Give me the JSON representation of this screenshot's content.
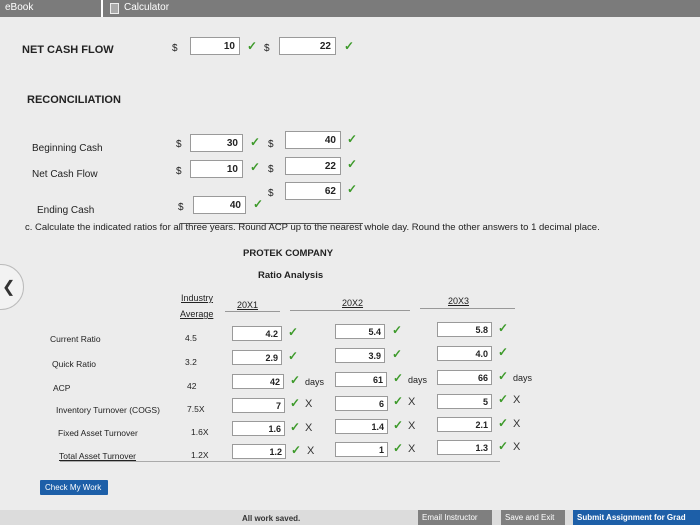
{
  "tabs": {
    "ebook": "eBook",
    "calculator": "Calculator"
  },
  "net_cash_flow": {
    "label": "NET CASH FLOW",
    "currency": "$",
    "val1": "10",
    "val2": "22"
  },
  "reconciliation": {
    "title": "RECONCILIATION",
    "currency": "$",
    "beginning_label": "Beginning Cash",
    "beginning_1": "30",
    "beginning_2": "40",
    "net_label": "Net Cash Flow",
    "net_1": "10",
    "net_2": "22",
    "extra_2": "62",
    "ending_label": "Ending Cash",
    "ending_1": "40"
  },
  "instruction": "c. Calculate the indicated ratios for all three years. Round ACP up to the nearest whole day. Round the other answers to 1 decimal place.",
  "company": "PROTEK COMPANY",
  "analysis_title": "Ratio Analysis",
  "columns": {
    "industry_1": "Industry",
    "industry_2": "Average",
    "y1": "20X1",
    "y2": "20X2",
    "y3": "20X3"
  },
  "rows": [
    {
      "label": "Current Ratio",
      "industry": "4.5",
      "y1": "4.2",
      "y2": "5.4",
      "y3": "5.8",
      "unit": ""
    },
    {
      "label": "Quick Ratio",
      "industry": "3.2",
      "y1": "2.9",
      "y2": "3.9",
      "y3": "4.0",
      "unit": ""
    },
    {
      "label": "ACP",
      "industry": "42",
      "y1": "42",
      "y2": "61",
      "y3": "66",
      "unit": "days"
    },
    {
      "label": "Inventory Turnover (COGS)",
      "industry": "7.5X",
      "y1": "7",
      "y2": "6",
      "y3": "5",
      "unit": ""
    },
    {
      "label": "Fixed Asset Turnover",
      "industry": "1.6X",
      "y1": "1.6",
      "y2": "1.4",
      "y3": "2.1",
      "unit": ""
    },
    {
      "label": "Total Asset Turnover",
      "industry": "1.2X",
      "y1": "1.2",
      "y2": "1",
      "y3": "1.3",
      "unit": ""
    }
  ],
  "marks": {
    "check": "✓",
    "cross": "X"
  },
  "buttons": {
    "check_work": "Check My Work",
    "email": "Email Instructor",
    "save": "Save and Exit",
    "submit": "Submit Assignment for Grad"
  },
  "status": "All work saved."
}
